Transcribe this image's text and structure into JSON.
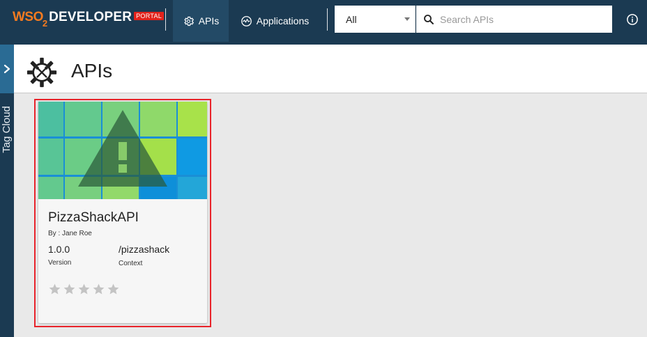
{
  "header": {
    "logo": {
      "wso": "WSO",
      "two": "2",
      "developer": "DEVELOPER",
      "portal": "PORTAL"
    },
    "nav": [
      {
        "label": "APIs",
        "icon": "gear-icon",
        "active": true
      },
      {
        "label": "Applications",
        "icon": "applications-icon",
        "active": false
      }
    ],
    "search": {
      "scope": "All",
      "placeholder": "Search APIs",
      "value": ""
    },
    "info_icon": "info-icon"
  },
  "sidebar": {
    "label": "Tag Cloud",
    "toggle_icon": "chevron-right-icon"
  },
  "page": {
    "title": "APIs",
    "title_icon": "api-gear-icon"
  },
  "apis": [
    {
      "name": "PizzaShackAPI",
      "by": "By : Jane Roe",
      "version": "1.0.0",
      "version_label": "Version",
      "context": "/pizzashack",
      "context_label": "Context",
      "rating": 0,
      "max_rating": 5,
      "thumbnail_icon": "warning-icon"
    }
  ],
  "colors": {
    "header_bg": "#1b3a52",
    "nav_active_bg": "#234a66",
    "logo_orange": "#f47b20",
    "portal_red": "#e2221b",
    "highlight_red": "#e8232a",
    "sidebar_toggle": "#2a6b94"
  }
}
